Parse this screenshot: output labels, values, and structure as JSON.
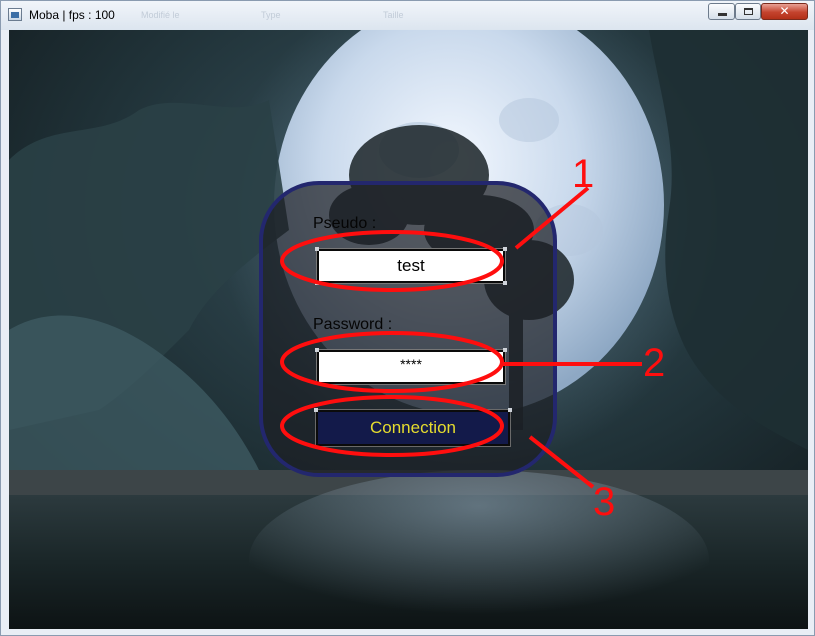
{
  "window": {
    "title": "Moba | fps : 100",
    "ghost_labels": [
      "Modifié le",
      "Type",
      "Taille"
    ],
    "controls": {
      "minimize": "minimize",
      "maximize": "maximize",
      "close": "✕"
    }
  },
  "login": {
    "pseudo_label": "Pseudo :",
    "pseudo_value": "test",
    "password_label": "Password :",
    "password_value": "****",
    "connect_label": "Connection"
  },
  "annotations": [
    "1",
    "2",
    "3"
  ],
  "colors": {
    "panel_border": "#23276e",
    "button_bg": "#131a4a",
    "button_text": "#e5dc2e",
    "annotation": "#ff0e0e"
  },
  "icons": [
    "app-icon",
    "minimize-icon",
    "maximize-icon",
    "close-icon"
  ]
}
